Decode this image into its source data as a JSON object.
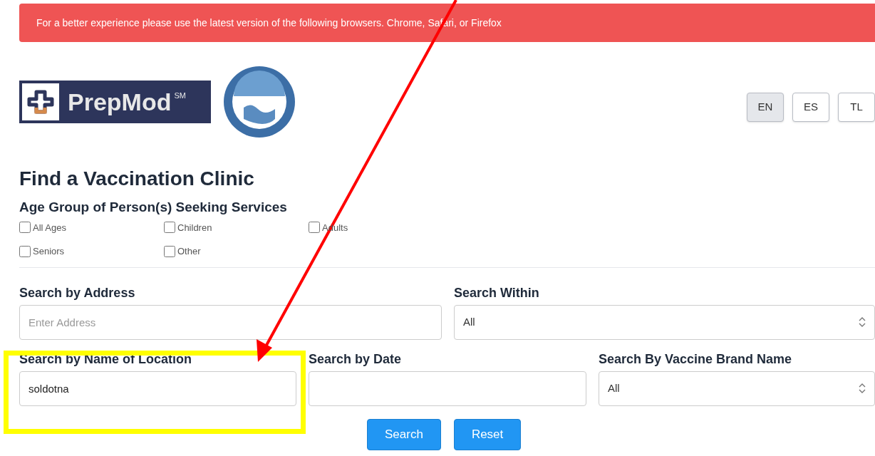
{
  "banner": {
    "text": "For a better experience please use the latest version of the following browsers. Chrome, Safari, or Firefox"
  },
  "logo": {
    "name": "PrepMod",
    "mark": "SM"
  },
  "languages": [
    {
      "label": "EN",
      "selected": true
    },
    {
      "label": "ES",
      "selected": false
    },
    {
      "label": "TL",
      "selected": false
    }
  ],
  "title": "Find a Vaccination Clinic",
  "age_group": {
    "label": "Age Group of Person(s) Seeking Services",
    "options": [
      {
        "label": "All Ages",
        "checked": false
      },
      {
        "label": "Children",
        "checked": false
      },
      {
        "label": "Adults",
        "checked": false
      },
      {
        "label": "Seniors",
        "checked": false
      },
      {
        "label": "Other",
        "checked": false
      }
    ]
  },
  "address": {
    "label": "Search by Address",
    "placeholder": "Enter Address"
  },
  "within": {
    "label": "Search Within",
    "value": "All"
  },
  "location": {
    "label": "Search by Name of Location",
    "value": "soldotna"
  },
  "date": {
    "label": "Search by Date"
  },
  "brand": {
    "label": "Search By Vaccine Brand Name",
    "value": "All"
  },
  "buttons": [
    "Search",
    "Reset"
  ]
}
